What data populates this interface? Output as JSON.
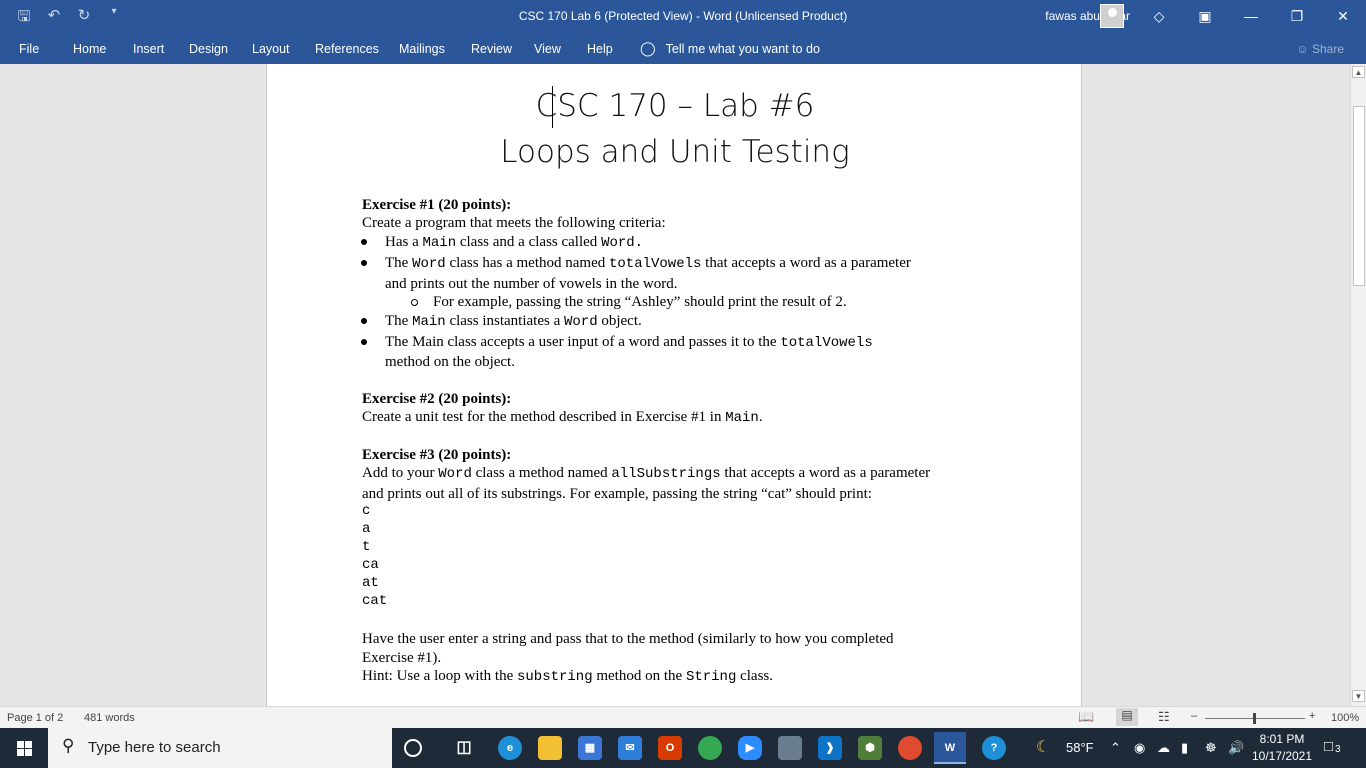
{
  "titlebar": {
    "title": "CSC 170 Lab 6 (Protected View)  -  Word (Unlicensed Product)",
    "user": "fawas abubakar"
  },
  "ribbon": {
    "tabs": [
      "File",
      "Home",
      "Insert",
      "Design",
      "Layout",
      "References",
      "Mailings",
      "Review",
      "View",
      "Help"
    ],
    "tell_me": "Tell me what you want to do",
    "share": "Share"
  },
  "document": {
    "title": "CSC 170 – Lab #6",
    "subtitle": "Loops and Unit Testing",
    "ex1": {
      "heading": "Exercise #1 (20 points):",
      "intro": "Create a program that meets the following criteria:",
      "b1_a": "Has a ",
      "b1_code1": "Main",
      "b1_b": " class and a class called ",
      "b1_code2": "Word.",
      "b2_a": "The ",
      "b2_code1": "Word",
      "b2_b": " class has a method named ",
      "b2_code2": "totalVowels",
      "b2_c": " that accepts a word as a parameter",
      "b2_line2": "and prints out the number of vowels in the word.",
      "sub1": "For example, passing the string “Ashley” should print the result of 2.",
      "b3_a": "The ",
      "b3_code1": "Main",
      "b3_b": " class instantiates a ",
      "b3_code2": "Word",
      "b3_c": " object.",
      "b4_a": "The Main class accepts a user input of a word and passes it to the ",
      "b4_code1": "totalVowels",
      "b4_line2": "method on the object."
    },
    "ex2": {
      "heading": "Exercise #2 (20 points):",
      "text_a": "Create a unit test for the method described in Exercise #1 in ",
      "code1": "Main",
      "text_b": "."
    },
    "ex3": {
      "heading": "Exercise #3 (20 points):",
      "l1_a": "Add to your ",
      "l1_code1": "Word",
      "l1_b": " class a method named ",
      "l1_code2": "allSubstrings",
      "l1_c": " that accepts a word as a parameter",
      "l2": "and prints out all of its substrings. For example, passing the string “cat” should print:",
      "output": [
        "c",
        "a",
        "t",
        "ca",
        "at",
        "cat"
      ],
      "p1": "Have the user enter a string and pass that to the method (similarly to how you completed",
      "p2": "Exercise #1).",
      "hint_a": "Hint: Use a loop with the ",
      "hint_code1": "substring",
      "hint_b": " method on the ",
      "hint_code2": "String",
      "hint_c": " class."
    }
  },
  "status": {
    "page": "Page 1 of 2",
    "words": "481 words",
    "zoom": "100%",
    "zoom_percent": 100
  },
  "taskbar": {
    "search_placeholder": "Type here to search",
    "temperature": "58°F",
    "time": "8:01 PM",
    "date": "10/17/2021",
    "notifications": "3"
  }
}
